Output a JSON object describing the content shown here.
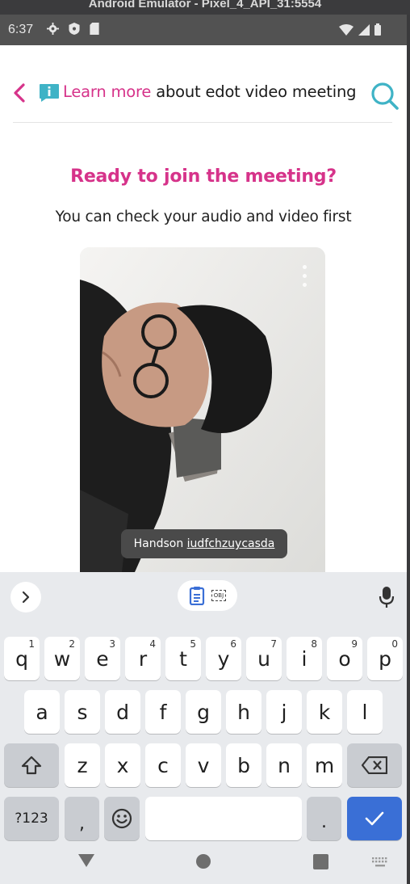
{
  "window": {
    "title": "Android Emulator - Pixel_4_API_31:5554"
  },
  "status_bar": {
    "time": "6:37"
  },
  "app_bar": {
    "link_text": "Learn more",
    "rest_text": " about edot video meeting"
  },
  "main": {
    "heading": "Ready to join the meeting?",
    "subheading": "You can check your audio and video first"
  },
  "video": {
    "name_first": "Handson ",
    "name_rest": "iudfchzuycasda"
  },
  "keyboard": {
    "row1": [
      {
        "label": "q",
        "hint": "1"
      },
      {
        "label": "w",
        "hint": "2"
      },
      {
        "label": "e",
        "hint": "3"
      },
      {
        "label": "r",
        "hint": "4"
      },
      {
        "label": "t",
        "hint": "5"
      },
      {
        "label": "y",
        "hint": "6"
      },
      {
        "label": "u",
        "hint": "7"
      },
      {
        "label": "i",
        "hint": "8"
      },
      {
        "label": "o",
        "hint": "9"
      },
      {
        "label": "p",
        "hint": "0"
      }
    ],
    "row2": [
      "a",
      "s",
      "d",
      "f",
      "g",
      "h",
      "j",
      "k",
      "l"
    ],
    "row3": [
      "z",
      "x",
      "c",
      "v",
      "b",
      "n",
      "m"
    ],
    "symbols_label": "?123",
    "comma_label": ",",
    "period_label": ".",
    "clipboard_tag": "OBJ"
  },
  "colors": {
    "accent_pink": "#d6338a",
    "accent_teal": "#3fb3c6",
    "enter_blue": "#3a6fd6"
  },
  "icons": {
    "back": "chevron-left-icon",
    "info": "info-bubble-icon",
    "search": "search-icon",
    "mic": "microphone-icon",
    "clipboard": "clipboard-icon",
    "shift": "shift-icon",
    "backspace": "backspace-icon",
    "emoji": "emoji-icon",
    "enter": "checkmark-icon"
  }
}
